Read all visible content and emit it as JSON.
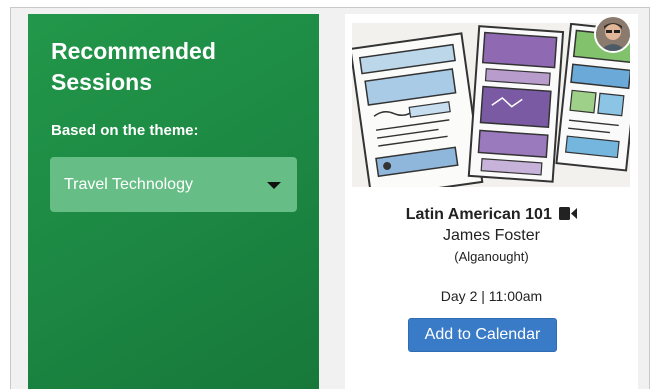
{
  "recommendations": {
    "title": "Recommended Sessions",
    "theme_label": "Based on the theme:",
    "theme_select": {
      "selected": "Travel Technology",
      "icon": "caret-down-icon"
    },
    "colors": {
      "panel_green": "#1d8a44",
      "select_green": "#66be86"
    }
  },
  "session_card": {
    "title": "Latin American 101",
    "title_icon": "video-camera-icon",
    "speaker": "James Foster",
    "company": "(Alganought)",
    "time": "Day 2 | 11:00am",
    "add_button": "Add to Calendar",
    "image": "wireframe-sketches-image",
    "avatar": "speaker-avatar",
    "colors": {
      "button_blue": "#3a7bc8"
    }
  }
}
